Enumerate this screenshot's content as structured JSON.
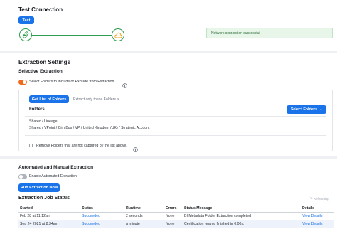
{
  "test_connection": {
    "title": "Test Connection",
    "test_button": "Test",
    "success_message": "Network connection successful",
    "source_icon": "link-icon",
    "target_icon": "cloud-icon",
    "colors": {
      "success": "#2e9e4f",
      "target_icon": "#f5a623"
    }
  },
  "extraction": {
    "title": "Extraction Settings",
    "selective_title": "Selective Extraction",
    "select_folders_toggle": {
      "label": "Select Folders to Include or Exclude from Extraction",
      "on": true
    },
    "get_list_button": "Get List of Folders",
    "extract_only_text": "Extract only these Folders >",
    "folders_label": "Folders",
    "select_folders_button": "Select Folders",
    "folders": [
      "Shared / Lineage",
      "Shared / VPoint / Cim Bus / VP / United Kingdom (UK) / Strategic Account"
    ],
    "remove_folders_checkbox": "Remove Folders that are not captured by the list above."
  },
  "automated": {
    "title": "Automated and Manual Extraction",
    "enable_toggle": {
      "label": "Enable Automated Extraction",
      "on": false
    },
    "run_button": "Run Extraction Now"
  },
  "job_status": {
    "title": "Extraction Job Status",
    "refreshing": "Refreshing",
    "columns": [
      "Started",
      "Status",
      "Runtime",
      "Errors",
      "Status Message",
      "Details"
    ],
    "rows": [
      {
        "started": "Feb 28 at 11:12am",
        "status": "Succeeded",
        "runtime": "2 seconds",
        "errors": "None",
        "message": "BI Metadata Folder Extraction completed",
        "details": "View Details"
      },
      {
        "started": "Sep 24 2021 at 8:34am",
        "status": "Succeeded",
        "runtime": "a minute",
        "errors": "None",
        "message": "Certification resync finished in 0.00s.",
        "details": "View Details"
      }
    ]
  }
}
